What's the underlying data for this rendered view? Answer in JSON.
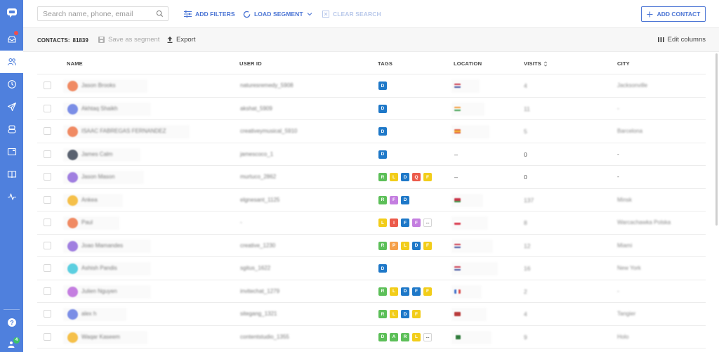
{
  "sidebar": {
    "items": [
      {
        "name": "logo",
        "icon": "chat-logo-icon"
      },
      {
        "name": "inbox",
        "icon": "inbox-icon",
        "has_notification": true
      },
      {
        "name": "contacts",
        "icon": "contacts-icon",
        "active": true
      },
      {
        "name": "history",
        "icon": "clock-icon"
      },
      {
        "name": "campaigns",
        "icon": "send-icon"
      },
      {
        "name": "bots",
        "icon": "bot-icon"
      },
      {
        "name": "widget",
        "icon": "widget-icon"
      },
      {
        "name": "knowledge-base",
        "icon": "book-icon"
      },
      {
        "name": "analytics",
        "icon": "pulse-icon"
      },
      {
        "name": "help",
        "icon": "help-icon"
      },
      {
        "name": "team",
        "icon": "team-icon",
        "badge": "4"
      }
    ]
  },
  "topbar": {
    "search_placeholder": "Search name, phone, email",
    "add_filters": "ADD FILTERS",
    "load_segment": "LOAD SEGMENT",
    "clear_search": "CLEAR SEARCH",
    "add_contact": "ADD CONTACT"
  },
  "subbar": {
    "contacts_label": "CONTACTS:",
    "contacts_count": "81839",
    "save_segment": "Save as segment",
    "export": "Export",
    "edit_columns": "Edit columns"
  },
  "table": {
    "columns": [
      "NAME",
      "USER ID",
      "TAGS",
      "LOCATION",
      "VISITS",
      "CITY"
    ],
    "rows": [
      {
        "name": "Jason Brooks",
        "avatar_color": "#f08a63",
        "user_id": "naturesremedy_5908",
        "tags": [
          [
            "D",
            "#1e78c8"
          ]
        ],
        "flag": "us",
        "visits": "4",
        "city": "Jacksonville",
        "blurred": true
      },
      {
        "name": "Akhtaq Shaikh",
        "avatar_color": "#7b8ee6",
        "user_id": "akshat_5909",
        "tags": [
          [
            "D",
            "#1e78c8"
          ]
        ],
        "flag": "in",
        "visits": "11",
        "city": "-",
        "blurred": true
      },
      {
        "name": "ISAAC FABREGAS FERNANDEZ",
        "avatar_color": "#f08a63",
        "user_id": "creativeymusical_5910",
        "tags": [
          [
            "D",
            "#1e78c8"
          ]
        ],
        "flag": "es",
        "visits": "5",
        "city": "Barcelona",
        "blurred": true
      },
      {
        "name": "James Calm",
        "avatar_color": "#5a6270",
        "user_id": "jamescoco_1",
        "tags": [
          [
            "D",
            "#1e78c8"
          ]
        ],
        "flag": null,
        "visits": "0",
        "city": "-",
        "blurred": false
      },
      {
        "name": "Jason Mason",
        "avatar_color": "#a07fe0",
        "user_id": "murtuco_2862",
        "tags": [
          [
            "R",
            "#5cbf58"
          ],
          [
            "L",
            "#f2cd1a"
          ],
          [
            "D",
            "#1e78c8"
          ],
          [
            "Q",
            "#ec5b4b"
          ],
          [
            "F",
            "#f2cd1a"
          ]
        ],
        "flag": null,
        "visits": "0",
        "city": "-",
        "blurred": false
      },
      {
        "name": "Ankea",
        "avatar_color": "#f5c04a",
        "user_id": "elgnesant_1125",
        "tags": [
          [
            "R",
            "#5cbf58"
          ],
          [
            "F",
            "#c47ee0"
          ],
          [
            "D",
            "#1e78c8"
          ]
        ],
        "flag": "by",
        "visits": "137",
        "city": "Minsk",
        "blurred": true
      },
      {
        "name": "Paul",
        "avatar_color": "#f08a63",
        "user_id": "-",
        "tags": [
          [
            "L",
            "#f2cd1a"
          ],
          [
            "I",
            "#ec5b4b"
          ],
          [
            "F",
            "#1e78c8"
          ],
          [
            "F",
            "#c47ee0"
          ],
          [
            "...",
            "more"
          ]
        ],
        "flag": "pl",
        "visits": "8",
        "city": "Warcachawka Polska",
        "blurred": true
      },
      {
        "name": "Joao Mamandes",
        "avatar_color": "#a07fe0",
        "user_id": "creative_1230",
        "tags": [
          [
            "R",
            "#5cbf58"
          ],
          [
            "P",
            "#f5a04a"
          ],
          [
            "L",
            "#f2cd1a"
          ],
          [
            "D",
            "#1e78c8"
          ],
          [
            "F",
            "#f2cd1a"
          ]
        ],
        "flag": "us",
        "visits": "12",
        "city": "Miami",
        "blurred": true
      },
      {
        "name": "Ashish Pandis",
        "avatar_color": "#5ccfe0",
        "user_id": "sgitus_1622",
        "tags": [
          [
            "D",
            "#1e78c8"
          ]
        ],
        "flag": "us",
        "visits": "16",
        "city": "New York",
        "blurred": true
      },
      {
        "name": "Julien Nguyen",
        "avatar_color": "#c47ee0",
        "user_id": "invitechat_1279",
        "tags": [
          [
            "R",
            "#5cbf58"
          ],
          [
            "L",
            "#f2cd1a"
          ],
          [
            "D",
            "#1e78c8"
          ],
          [
            "F",
            "#1e78c8"
          ],
          [
            "F",
            "#f2cd1a"
          ]
        ],
        "flag": "fr",
        "visits": "2",
        "city": "-",
        "blurred": true
      },
      {
        "name": "alex h",
        "avatar_color": "#7b8ee6",
        "user_id": "sitegang_1321",
        "tags": [
          [
            "R",
            "#5cbf58"
          ],
          [
            "L",
            "#f2cd1a"
          ],
          [
            "D",
            "#1e78c8"
          ],
          [
            "F",
            "#f2cd1a"
          ]
        ],
        "flag": "ma",
        "visits": "4",
        "city": "Tangier",
        "blurred": true
      },
      {
        "name": "Waqar Kaseem",
        "avatar_color": "#f5c04a",
        "user_id": "contentstudio_1355",
        "tags": [
          [
            "D",
            "#5cbf58"
          ],
          [
            "A",
            "#5cbf58"
          ],
          [
            "R",
            "#5cbf58"
          ],
          [
            "L",
            "#f2cd1a"
          ],
          [
            "...",
            "more"
          ]
        ],
        "flag": "pk",
        "visits": "9",
        "city": "Holo",
        "blurred": true
      }
    ]
  },
  "colors": {
    "sidebar": "#4f80dd",
    "accent": "#4a74d4",
    "notification": "#ef4e4e",
    "badge_green": "#3cc36a"
  }
}
